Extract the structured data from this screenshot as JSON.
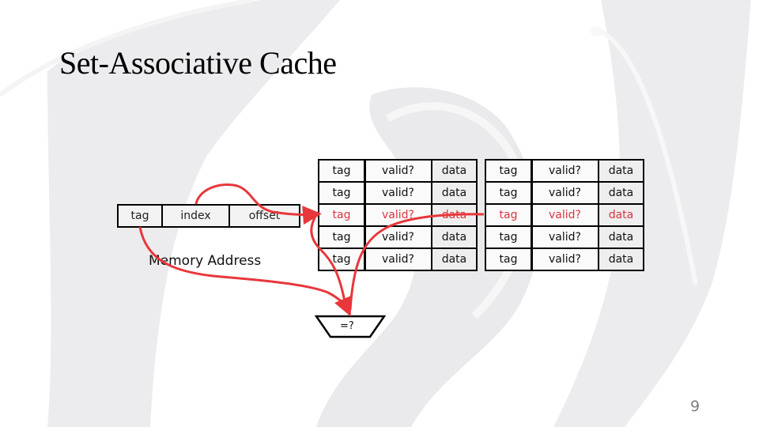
{
  "slide": {
    "title": "Set-Associative Cache",
    "page_number": "9"
  },
  "memory_address": {
    "label": "Memory Address",
    "fields": [
      "tag",
      "index",
      "offset"
    ]
  },
  "cache": {
    "ways": [
      {
        "columns": [
          "tag",
          "valid?",
          "data"
        ],
        "rows": [
          [
            "tag",
            "valid?",
            "data"
          ],
          [
            "tag",
            "valid?",
            "data"
          ],
          [
            "tag",
            "valid?",
            "data"
          ],
          [
            "tag",
            "valid?",
            "data"
          ],
          [
            "tag",
            "valid?",
            "data"
          ]
        ],
        "highlighted_row": 2
      },
      {
        "columns": [
          "tag",
          "valid?",
          "data"
        ],
        "rows": [
          [
            "tag",
            "valid?",
            "data"
          ],
          [
            "tag",
            "valid?",
            "data"
          ],
          [
            "tag",
            "valid?",
            "data"
          ],
          [
            "tag",
            "valid?",
            "data"
          ],
          [
            "tag",
            "valid?",
            "data"
          ]
        ],
        "highlighted_row": 2
      }
    ]
  },
  "comparator": {
    "label": "=?"
  },
  "colors": {
    "arrow": "#e8373b",
    "highlight_text": "#d9363e",
    "background_watermark": "#e9e9eb",
    "page_number": "#7f7f7f"
  }
}
